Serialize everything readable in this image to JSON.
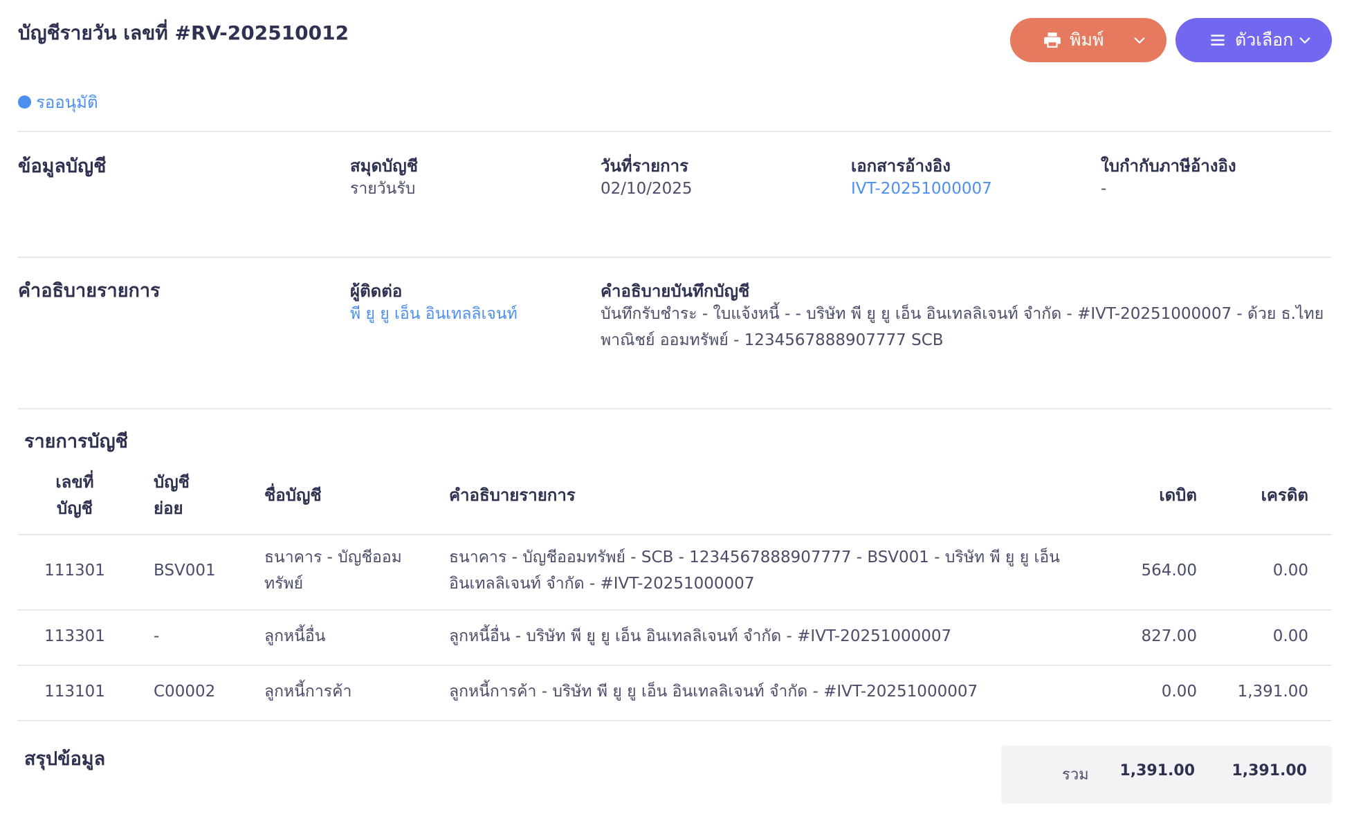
{
  "header": {
    "title": "บัญชีรายวัน เลขที่ #RV-202510012",
    "print_label": "พิมพ์",
    "options_label": "ตัวเลือก",
    "status": "รออนุมัติ",
    "colors": {
      "print": "#e57a5f",
      "options": "#7367f0",
      "status": "#4c8ff0"
    }
  },
  "info": {
    "section_title": "ข้อมูลบัญชี",
    "journal_label": "สมุดบัญชี",
    "journal_value": "รายวันรับ",
    "date_label": "วันที่รายการ",
    "date_value": "02/10/2025",
    "ref_label": "เอกสารอ้างอิง",
    "ref_value": "IVT-20251000007",
    "tax_label": "ใบกำกับภาษีอ้างอิง",
    "tax_value": "-"
  },
  "desc": {
    "section_title": "คำอธิบายรายการ",
    "contact_label": "ผู้ติดต่อ",
    "contact_value": "พี ยู ยู เอ็น อินเทลลิเจนท์",
    "note_label": "คำอธิบายบันทึกบัญชี",
    "note_line1": "บันทึกรับชำระ - ใบแจ้งหนี้ - - บริษัท พี ยู ยู เอ็น อินเทลลิเจนท์ จำกัด - #IVT-20251000007 - ด้วย ธ.ไทย",
    "note_line2": "พาณิชย์ ออมทรัพย์ - 1234567888907777 SCB"
  },
  "entries": {
    "section_title": "รายการบัญชี",
    "headers": {
      "account_no_1": "เลขที่",
      "account_no_2": "บัญชี",
      "sub_1": "บัญชี",
      "sub_2": "ย่อย",
      "name": "ชื่อบัญชี",
      "desc": "คำอธิบายรายการ",
      "debit": "เดบิต",
      "credit": "เครดิต"
    },
    "rows": [
      {
        "account_no": "111301",
        "sub": "BSV001",
        "name_1": "ธนาคาร - บัญชีออม",
        "name_2": "ทรัพย์",
        "desc_1": "ธนาคาร - บัญชีออมทรัพย์ - SCB - 1234567888907777 - BSV001 - บริษัท พี ยู ยู เอ็น",
        "desc_2": "อินเทลลิเจนท์ จำกัด - #IVT-20251000007",
        "debit": "564.00",
        "credit": "0.00"
      },
      {
        "account_no": "113301",
        "sub": "-",
        "name_1": "ลูกหนี้อื่น",
        "desc_1": "ลูกหนี้อื่น - บริษัท พี ยู ยู เอ็น อินเทลลิเจนท์ จำกัด - #IVT-20251000007",
        "debit": "827.00",
        "credit": "0.00"
      },
      {
        "account_no": "113101",
        "sub": "C00002",
        "name_1": "ลูกหนี้การค้า",
        "desc_1": "ลูกหนี้การค้า - บริษัท พี ยู ยู เอ็น อินเทลลิเจนท์ จำกัด - #IVT-20251000007",
        "debit": "0.00",
        "credit": "1,391.00"
      }
    ]
  },
  "summary": {
    "section_title": "สรุปข้อมูล",
    "total_label": "รวม",
    "total_debit": "1,391.00",
    "total_credit": "1,391.00"
  }
}
